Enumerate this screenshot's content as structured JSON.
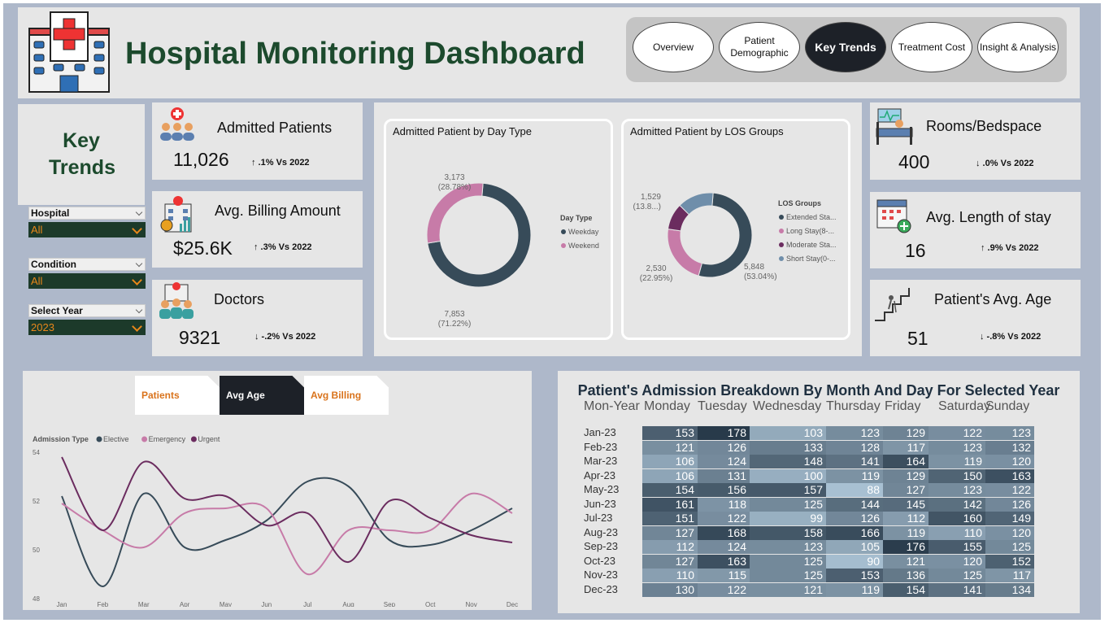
{
  "header": {
    "title": "Hospital Monitoring Dashboard",
    "nav": [
      {
        "label": "Overview",
        "active": false
      },
      {
        "label": "Patient Demographic",
        "active": false
      },
      {
        "label": "Key Trends",
        "active": true
      },
      {
        "label": "Treatment Cost",
        "active": false
      },
      {
        "label": "Insight & Analysis",
        "active": false
      }
    ]
  },
  "section_title": "Key Trends",
  "filters": [
    {
      "label": "Hospital",
      "value": "All"
    },
    {
      "label": "Condition",
      "value": "All"
    },
    {
      "label": "Select Year",
      "value": "2023"
    }
  ],
  "kpis_left": [
    {
      "label": "Admitted Patients",
      "value": "11,026",
      "change": "↑ .1% Vs 2022",
      "icon": "admitted-patients-icon"
    },
    {
      "label": "Avg. Billing Amount",
      "value": "$25.6K",
      "change": "↑ .3% Vs 2022",
      "icon": "billing-icon"
    },
    {
      "label": "Doctors",
      "value": "9321",
      "change": "↓ -.2% Vs 2022",
      "icon": "doctors-icon"
    }
  ],
  "kpis_right": [
    {
      "label": "Rooms/Bedspace",
      "value": "400",
      "change": "↓ .0% Vs 2022",
      "icon": "bed-icon"
    },
    {
      "label": "Avg. Length of stay",
      "value": "16",
      "change": "↑ .9% Vs 2022",
      "icon": "calendar-icon"
    },
    {
      "label": "Patient's Avg. Age",
      "value": "51",
      "change": "↓ -.8% Vs 2022",
      "icon": "stairs-icon"
    }
  ],
  "colors": {
    "dark": "#374b59",
    "pink": "#c77ba8",
    "purple": "#6b2c5f",
    "blue": "#6f8eaa",
    "green": "#1c4a2d"
  },
  "chart_data": [
    {
      "type": "pie",
      "title": "Admitted Patient by Day Type",
      "legend_title": "Day Type",
      "legend_position": "right",
      "slices": [
        {
          "name": "Weekday",
          "value": 7853,
          "label": "7,853",
          "pct": "(71.22%)"
        },
        {
          "name": "Weekend",
          "value": 3173,
          "label": "3,173",
          "pct": "(28.78%)"
        }
      ]
    },
    {
      "type": "pie",
      "title": "Admitted Patient by LOS Groups",
      "legend_title": "LOS Groups",
      "legend_position": "right",
      "slices": [
        {
          "name": "Extended Sta...",
          "value": 5848,
          "label": "5,848",
          "pct": "(53.04%)"
        },
        {
          "name": "Long Stay(8-...",
          "value": 2530,
          "label": "2,530",
          "pct": "(22.95%)"
        },
        {
          "name": "Moderate Sta...",
          "value": 1119,
          "label": "",
          "pct": ""
        },
        {
          "name": "Short Stay(0-...",
          "value": 1529,
          "label": "1,529",
          "pct": "(13.8...)"
        }
      ]
    },
    {
      "type": "line",
      "tabs": [
        "Patients",
        "Avg Age",
        "Avg Billing"
      ],
      "active_tab": "Avg Age",
      "legend_title": "Admission Type",
      "legend_position": "top-left",
      "x": [
        "Jan",
        "Feb",
        "Mar",
        "Apr",
        "May",
        "Jun",
        "Jul",
        "Aug",
        "Sep",
        "Oct",
        "Nov",
        "Dec"
      ],
      "ylim": [
        48,
        54
      ],
      "yticks": [
        48,
        50,
        52,
        54
      ],
      "series": [
        {
          "name": "Elective",
          "values": [
            52.2,
            48.5,
            52.3,
            50.1,
            50.4,
            51.2,
            52.8,
            52.6,
            50.4,
            50.2,
            50.8,
            51.7
          ]
        },
        {
          "name": "Emergency",
          "values": [
            51.9,
            50.8,
            50.1,
            51.5,
            51.7,
            51.7,
            49.0,
            50.8,
            50.8,
            50.8,
            52.3,
            51.5
          ]
        },
        {
          "name": "Urgent",
          "values": [
            53.8,
            50.8,
            53.6,
            52.1,
            52.2,
            51.0,
            51.5,
            49.5,
            52.0,
            51.3,
            50.6,
            50.3
          ]
        }
      ]
    },
    {
      "type": "heatmap",
      "title": "Patient's Admission Breakdown By Month And Day For Selected Year",
      "row_header": "Mon-Year",
      "columns": [
        "Monday",
        "Tuesday",
        "Wednesday",
        "Thursday",
        "Friday",
        "Saturday",
        "Sunday"
      ],
      "rows": [
        "Jan-23",
        "Feb-23",
        "Mar-23",
        "Apr-23",
        "May-23",
        "Jun-23",
        "Jul-23",
        "Aug-23",
        "Sep-23",
        "Oct-23",
        "Nov-23",
        "Dec-23"
      ],
      "values": [
        [
          153,
          178,
          103,
          123,
          129,
          122,
          123
        ],
        [
          121,
          126,
          133,
          128,
          117,
          123,
          132
        ],
        [
          106,
          124,
          148,
          141,
          164,
          119,
          120
        ],
        [
          106,
          131,
          100,
          119,
          129,
          150,
          163
        ],
        [
          154,
          156,
          157,
          88,
          127,
          123,
          122
        ],
        [
          161,
          118,
          125,
          144,
          145,
          142,
          126
        ],
        [
          151,
          122,
          99,
          126,
          112,
          160,
          149
        ],
        [
          127,
          168,
          158,
          166,
          119,
          110,
          120
        ],
        [
          112,
          124,
          123,
          105,
          176,
          155,
          125
        ],
        [
          127,
          163,
          125,
          90,
          121,
          120,
          152
        ],
        [
          110,
          115,
          125,
          153,
          136,
          125,
          117
        ],
        [
          130,
          122,
          121,
          119,
          154,
          141,
          134
        ]
      ]
    }
  ]
}
